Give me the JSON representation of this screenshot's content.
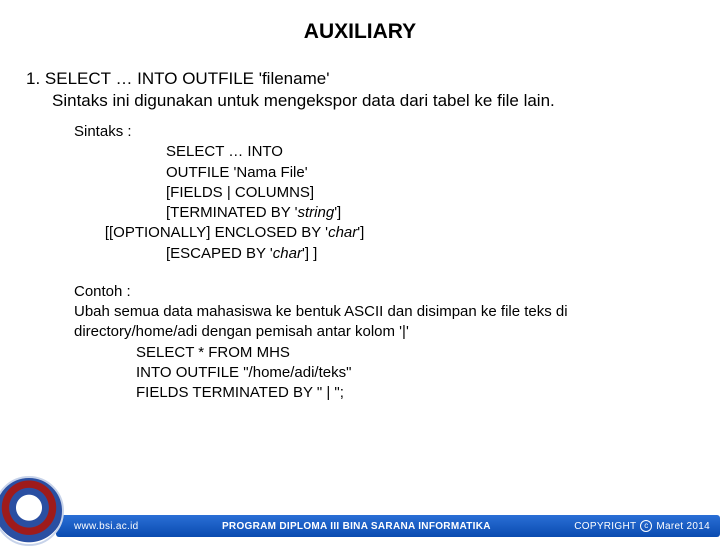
{
  "title": "AUXILIARY",
  "intro": {
    "line1": "1. SELECT … INTO OUTFILE 'filename'",
    "line2": "Sintaks ini digunakan untuk mengekspor data dari tabel ke file lain."
  },
  "syntax": {
    "label": "Sintaks  :",
    "lines_main": "SELECT … INTO\nOUTFILE 'Nama File'\n[FIELDS | COLUMNS]\n[TERMINATED BY '",
    "string_word": "string",
    "after_string": "']",
    "shifted_line": "     [[OPTIONALLY] ENCLOSED BY '",
    "char1": "char",
    "after_char1": "']",
    "escaped_line": "[ESCAPED BY '",
    "char2": "char",
    "after_char2": "'] ]"
  },
  "example": {
    "heading": "Contoh :",
    "desc": "Ubah semua data mahasiswa ke bentuk ASCII dan disimpan ke file teks di directory/home/adi dengan pemisah antar kolom '|'",
    "code": "SELECT * FROM MHS\nINTO OUTFILE \"/home/adi/teks\"\nFIELDS TERMINATED BY \" | \";"
  },
  "footer": {
    "url": "www.bsi.ac.id",
    "program": "PROGRAM DIPLOMA III BINA SARANA INFORMATIKA",
    "copyright_label": "COPYRIGHT",
    "copyright_date": "Maret 2014"
  }
}
